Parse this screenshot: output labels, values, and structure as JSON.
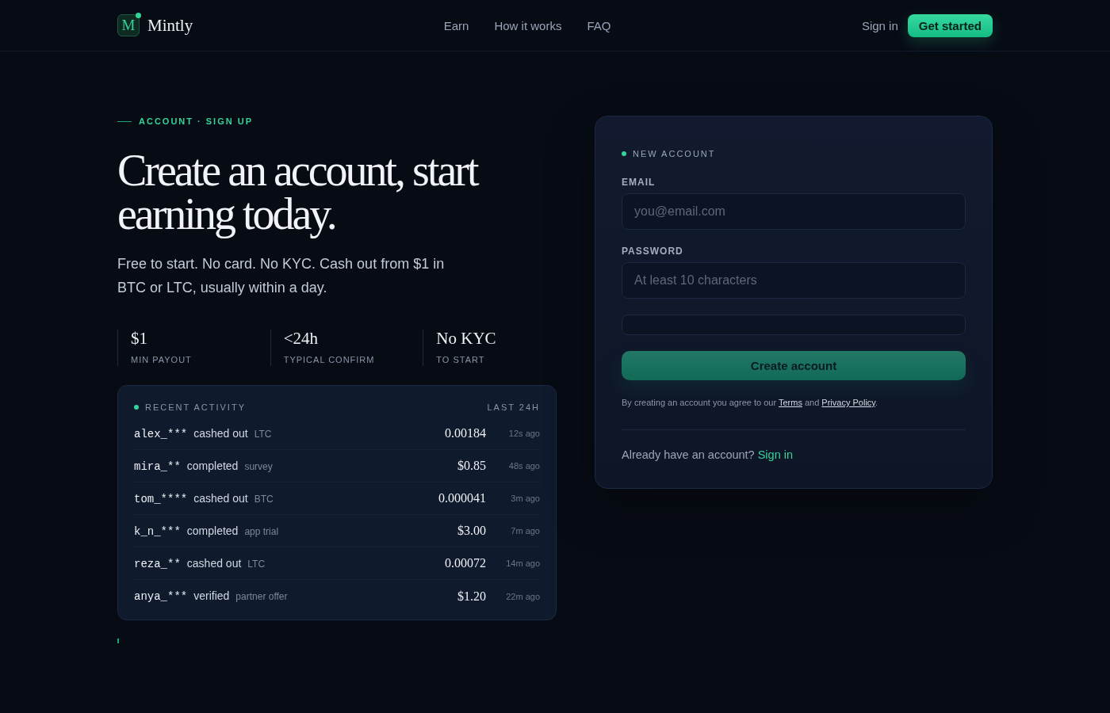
{
  "nav": {
    "logo": {
      "letter": "M",
      "name": "Mintly"
    },
    "links": [
      {
        "label": "Earn"
      },
      {
        "label": "How it works"
      },
      {
        "label": "FAQ"
      }
    ],
    "sign_in": "Sign in",
    "cta": "Get started"
  },
  "hero": {
    "eyebrow": "ACCOUNT · SIGN UP",
    "title": "Create an account, start earning today.",
    "lead": "Free to start. No card. No KYC. Cash out from $1 in BTC or LTC, usually within a day.",
    "stats": [
      {
        "value": "$1",
        "label": "MIN PAYOUT"
      },
      {
        "value": "<24h",
        "label": "TYPICAL CONFIRM"
      },
      {
        "value": "No KYC",
        "label": "TO START"
      }
    ]
  },
  "activity": {
    "title": "RECENT ACTIVITY",
    "period": "LAST 24H",
    "rows": [
      {
        "user": "alex_***",
        "action": "cashed out",
        "detail": "LTC",
        "amount": "0.00184",
        "time": "12s ago"
      },
      {
        "user": "mira_**",
        "action": "completed",
        "detail": "survey",
        "amount": "$0.85",
        "time": "48s ago"
      },
      {
        "user": "tom_****",
        "action": "cashed out",
        "detail": "BTC",
        "amount": "0.000041",
        "time": "3m ago"
      },
      {
        "user": "k_n_***",
        "action": "completed",
        "detail": "app trial",
        "amount": "$3.00",
        "time": "7m ago"
      },
      {
        "user": "reza_**",
        "action": "cashed out",
        "detail": "LTC",
        "amount": "0.00072",
        "time": "14m ago"
      },
      {
        "user": "anya_***",
        "action": "verified",
        "detail": "partner offer",
        "amount": "$1.20",
        "time": "22m ago"
      }
    ]
  },
  "signup_form": {
    "eyebrow": "NEW ACCOUNT",
    "fields": [
      {
        "kind": "text",
        "label": "EMAIL",
        "placeholder": "you@email.com"
      },
      {
        "kind": "text",
        "label": "PASSWORD",
        "placeholder": "At least 10 characters"
      },
      {
        "kind": "blank"
      }
    ],
    "submit": {
      "label": "Create account",
      "disabled": true
    },
    "legal": {
      "text": "By creating an account you agree to our",
      "terms": "Terms",
      "joiner": "and",
      "privacy": "Privacy Policy",
      "end": "."
    },
    "footer": {
      "text": "Already have an account?",
      "link": "Sign in"
    }
  }
}
